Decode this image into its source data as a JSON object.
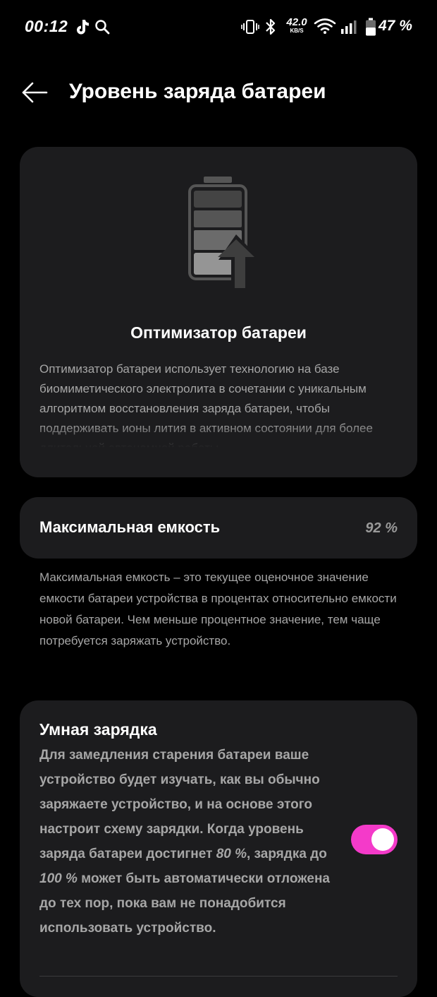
{
  "status_bar": {
    "time": "00:12",
    "net_speed_value": "42.0",
    "net_speed_unit": "KB/S",
    "battery_percent": "47 %",
    "icons": [
      "tiktok-icon",
      "search-icon",
      "vibrate-icon",
      "bluetooth-icon",
      "wifi-icon",
      "signal-icon",
      "battery-icon"
    ]
  },
  "header": {
    "title": "Уровень заряда батареи"
  },
  "optimizer": {
    "title": "Оптимизатор батареи",
    "description": "Оптимизатор батареи использует технологию на базе биомиметического электролита в сочетании с уникальным алгоритмом восстановления заряда батареи, чтобы поддерживать ионы лития в активном состоянии для более длительной автономной работы."
  },
  "capacity": {
    "label": "Максимальная емкость",
    "value": "92 %",
    "description": "Максимальная емкость – это текущее оценочное значение емкости батареи устройства в процентах относительно емкости новой батареи. Чем меньше процентное значение, тем чаще потребуется заряжать устройство."
  },
  "smart_charging": {
    "title": "Умная зарядка",
    "desc_part1": "Для замедления старения батареи ваше устройство будет изучать, как вы обычно заряжаете устройство, и на основе этого настроит схему зарядки. Когда уровень заряда батареи достигнет ",
    "desc_value1": "80 %",
    "desc_part2": ", зарядка до ",
    "desc_value2": "100 %",
    "desc_part3": " может быть автоматически отложена до тех пор, пока вам не понадобится использовать устройство.",
    "enabled": true
  },
  "colors": {
    "background": "#000000",
    "card": "#1c1c1e",
    "secondary_text": "#a6a6a6",
    "toggle_on": "#f43ac9"
  }
}
